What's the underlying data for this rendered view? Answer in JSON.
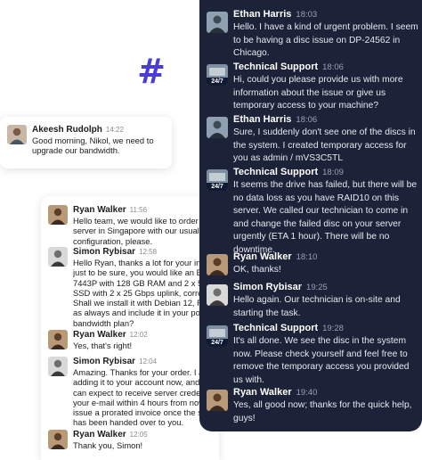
{
  "colors": {
    "accent": "#4a3cd6",
    "dark_panel": "#1c2238"
  },
  "left_panel": {
    "akeesh": {
      "name": "Akeesh Rudolph",
      "time": "14:22",
      "text": "Good morning, Nikol, we need to\nupgrade our bandwidth."
    },
    "messages": [
      {
        "name": "Ryan Walker",
        "time": "11:56",
        "avatar": "ryan-avatar",
        "text": "Hello team, we would like to order o\nserver in Singapore with our usual\nconfiguration, please."
      },
      {
        "name": "Simon Rybisar",
        "time": "12:58",
        "avatar": "simon-avatar",
        "text": "Hello Ryan, thanks a lot for your inqu\njust to be sure, you would like an EPY\n7443P with 128 GB RAM and 2 x 50\nSSD with 2 x 25 Gbps uplink, correc\nShall we install it with Debian 12, RAI\nas always and include it in your poole\nbandwidth plan?"
      },
      {
        "name": "Ryan Walker",
        "time": "12:02",
        "avatar": "ryan-avatar",
        "text": "Yes, that's right!"
      },
      {
        "name": "Simon Rybisar",
        "time": "12:04",
        "avatar": "simon-avatar",
        "text": "Amazing. Thanks for your order. I am\nadding it to your account now, and yo\ncan expect to receive server credent\nyour e-mail within 4 hours from now\nissue a prorated invoice once the ser\nhas been handed over to you."
      },
      {
        "name": "Ryan Walker",
        "time": "12:05",
        "avatar": "ryan-avatar",
        "text": "Thank you, Simon!"
      }
    ]
  },
  "dark_panel": {
    "badge_text": "24/7",
    "messages": [
      {
        "name": "Ethan Harris",
        "time": "18:03",
        "avatar": "ethan",
        "text": "Hello. I have a kind of urgent problem. I seem\nto be having a disc issue on DP-24562 in\nChicago."
      },
      {
        "name": "Technical Support",
        "time": "18:06",
        "avatar": "support",
        "text": "Hi, could you please provide us with more\ninformation about the issue or give us\ntemporary access to your machine?"
      },
      {
        "name": "Ethan Harris",
        "time": "18:06",
        "avatar": "ethan",
        "text": "Sure, I suddenly don't see one of the discs in\nthe system. I created temporary access for\nyou as admin / mVS3C5TL"
      },
      {
        "name": "Technical Support",
        "time": "18:09",
        "avatar": "support",
        "text": "It seems the drive has failed, but there will be\nno data loss as you have RAID10 on this\nserver. We called our technician to come in\nand change the failed disc on your server\nurgently (ETA 1 hour). There will be no\ndowntime."
      },
      {
        "name": "Ryan Walker",
        "time": "18:10",
        "avatar": "ryan",
        "text": "OK, thanks!"
      },
      {
        "name": "Simon Rybisar",
        "time": "19:25",
        "avatar": "simon",
        "text": "Hello again. Our technician is on-site and\nstarting the task."
      },
      {
        "name": "Technical Support",
        "time": "19:28",
        "avatar": "support",
        "text": "It's all done. We see the disc in the system\nnow. Please check yourself and feel free to\nremove the temporary access you provided\nus with."
      },
      {
        "name": "Ryan Walker",
        "time": "19:40",
        "avatar": "ryan",
        "text": "Yes, all good now; thanks for the quick help,\nguys!"
      }
    ]
  }
}
